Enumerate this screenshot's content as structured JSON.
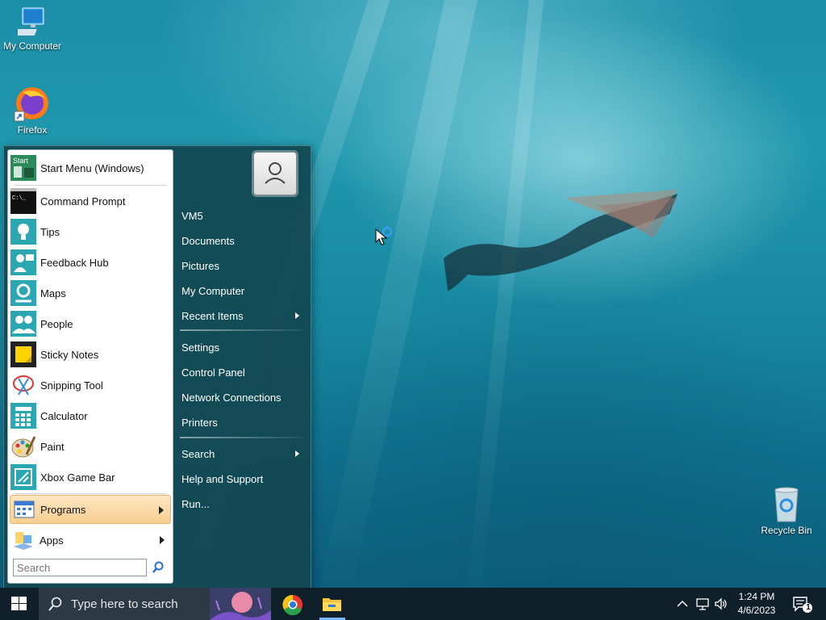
{
  "desktop": {
    "icons": [
      {
        "label": "My Computer"
      },
      {
        "label": "Firefox"
      },
      {
        "label": "Recycle Bin"
      }
    ]
  },
  "start_menu": {
    "pinned": [
      {
        "label": "Start Menu (Windows)",
        "icon": "start-menu-icon"
      },
      {
        "label": "Command Prompt",
        "icon": "command-prompt-icon"
      },
      {
        "label": "Tips",
        "icon": "tips-lightbulb-icon"
      },
      {
        "label": "Feedback Hub",
        "icon": "feedback-hub-icon"
      },
      {
        "label": "Maps",
        "icon": "maps-icon"
      },
      {
        "label": "People",
        "icon": "people-icon"
      },
      {
        "label": "Sticky Notes",
        "icon": "sticky-notes-icon"
      },
      {
        "label": "Snipping Tool",
        "icon": "snipping-tool-icon"
      },
      {
        "label": "Calculator",
        "icon": "calculator-icon"
      },
      {
        "label": "Paint",
        "icon": "paint-icon"
      },
      {
        "label": "Xbox Game Bar",
        "icon": "xbox-game-bar-icon"
      }
    ],
    "programs_label": "Programs",
    "apps_label": "Apps",
    "search_placeholder": "Search",
    "right": {
      "items": [
        "VM5",
        "Documents",
        "Pictures",
        "My Computer",
        "Recent Items",
        "Settings",
        "Control Panel",
        "Network Connections",
        "Printers",
        "Search",
        "Help and Support",
        "Run..."
      ]
    }
  },
  "taskbar": {
    "search_placeholder": "Type here to search",
    "time": "1:24 PM",
    "date": "4/6/2023",
    "notification_count": "1"
  },
  "colors": {
    "accent_taskbar": "#10202a",
    "start_menu_bg": "#124852",
    "highlight": "#f8cf91"
  }
}
